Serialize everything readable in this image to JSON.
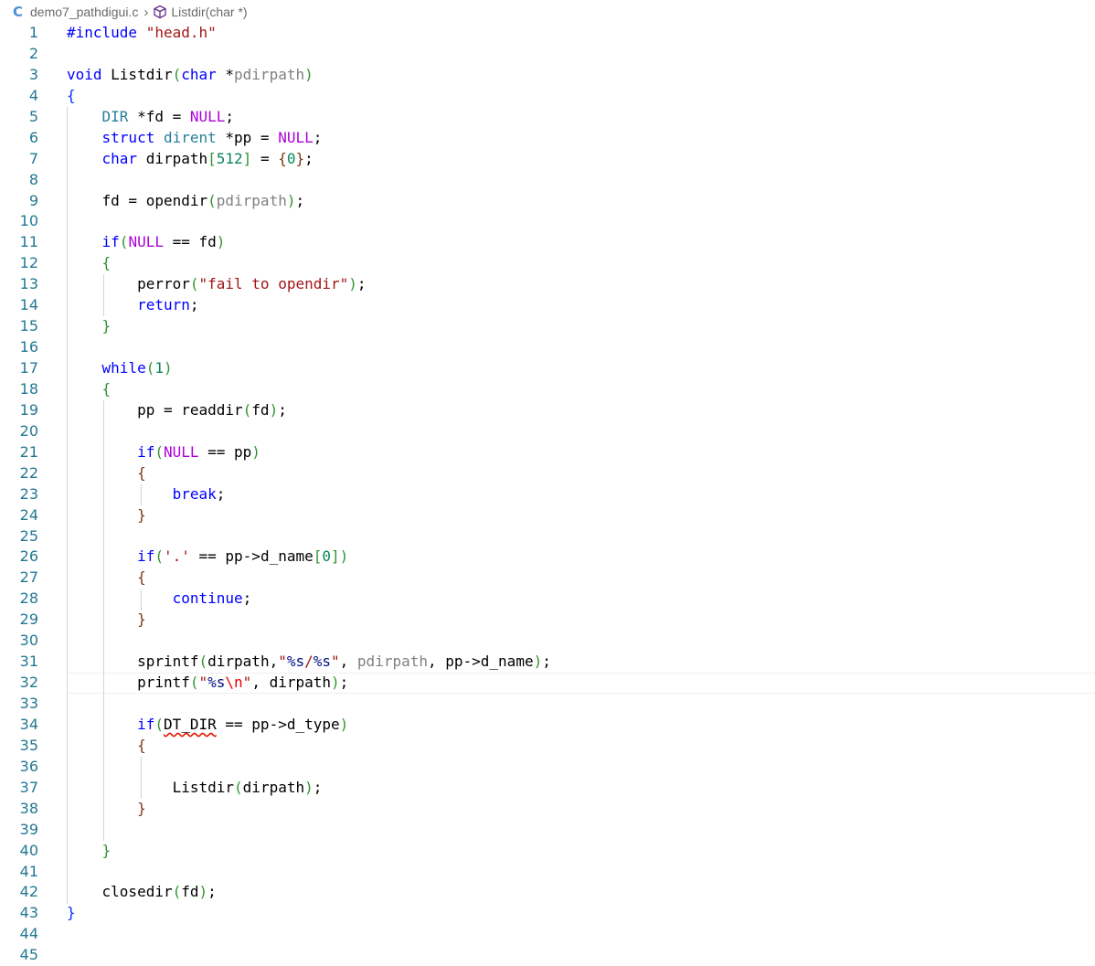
{
  "breadcrumb": {
    "language_icon": "C",
    "file": "demo7_pathdigui.c",
    "separator_icon": "chevron-right",
    "symbol_icon": "cube-icon",
    "symbol": "Listdir(char *)"
  },
  "editor": {
    "current_line": 32,
    "lines": [
      {
        "n": "1",
        "t": "#include \"head.h\""
      },
      {
        "n": "2",
        "t": ""
      },
      {
        "n": "3",
        "t": "void Listdir(char *pdirpath)"
      },
      {
        "n": "4",
        "t": "{"
      },
      {
        "n": "5",
        "t": "    DIR *fd = NULL;"
      },
      {
        "n": "6",
        "t": "    struct dirent *pp = NULL;"
      },
      {
        "n": "7",
        "t": "    char dirpath[512] = {0};"
      },
      {
        "n": "8",
        "t": ""
      },
      {
        "n": "9",
        "t": "    fd = opendir(pdirpath);"
      },
      {
        "n": "10",
        "t": ""
      },
      {
        "n": "11",
        "t": "    if(NULL == fd)"
      },
      {
        "n": "12",
        "t": "    {"
      },
      {
        "n": "13",
        "t": "        perror(\"fail to opendir\");"
      },
      {
        "n": "14",
        "t": "        return;"
      },
      {
        "n": "15",
        "t": "    }"
      },
      {
        "n": "16",
        "t": ""
      },
      {
        "n": "17",
        "t": "    while(1)"
      },
      {
        "n": "18",
        "t": "    {"
      },
      {
        "n": "19",
        "t": "        pp = readdir(fd);"
      },
      {
        "n": "20",
        "t": ""
      },
      {
        "n": "21",
        "t": "        if(NULL == pp)"
      },
      {
        "n": "22",
        "t": "        {"
      },
      {
        "n": "23",
        "t": "            break;"
      },
      {
        "n": "24",
        "t": "        }"
      },
      {
        "n": "25",
        "t": ""
      },
      {
        "n": "26",
        "t": "        if('.' == pp->d_name[0])"
      },
      {
        "n": "27",
        "t": "        {"
      },
      {
        "n": "28",
        "t": "            continue;"
      },
      {
        "n": "29",
        "t": "        }"
      },
      {
        "n": "30",
        "t": ""
      },
      {
        "n": "31",
        "t": "        sprintf(dirpath,\"%s/%s\", pdirpath, pp->d_name);"
      },
      {
        "n": "32",
        "t": "        printf(\"%s\\n\", dirpath);"
      },
      {
        "n": "33",
        "t": ""
      },
      {
        "n": "34",
        "t": "        if(DT_DIR == pp->d_type)"
      },
      {
        "n": "35",
        "t": "        {"
      },
      {
        "n": "36",
        "t": ""
      },
      {
        "n": "37",
        "t": "            Listdir(dirpath);"
      },
      {
        "n": "38",
        "t": "        }"
      },
      {
        "n": "39",
        "t": ""
      },
      {
        "n": "40",
        "t": "    }"
      },
      {
        "n": "41",
        "t": ""
      },
      {
        "n": "42",
        "t": "    closedir(fd);"
      },
      {
        "n": "43",
        "t": "}"
      },
      {
        "n": "44",
        "t": ""
      },
      {
        "n": "45",
        "t": ""
      }
    ]
  },
  "colors": {
    "line_number": "#237893",
    "keyword": "#0000ff",
    "control": "#af00db",
    "type": "#267f99",
    "string": "#a31515",
    "number": "#098658",
    "function": "#795e26",
    "error_squiggle": "#e51400"
  }
}
